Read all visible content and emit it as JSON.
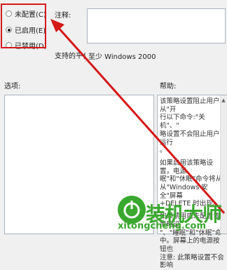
{
  "state": {
    "options": [
      {
        "label": "未配置(C)",
        "checked": false
      },
      {
        "label": "已启用(E)",
        "checked": true
      },
      {
        "label": "已禁用(D)",
        "checked": false
      }
    ]
  },
  "comment": {
    "label": "注释:"
  },
  "supported": {
    "label": "支持的平台",
    "value": "至少 Windows 2000"
  },
  "options_section": {
    "label": "选项:"
  },
  "help_section": {
    "label": "帮助:",
    "lines": [
      "该策略设置阻止用户从\"开",
      "行以下命令:\"关机\"、\"",
      "略设置不会阻止用户运行",
      "。",
      "如果启用该策略设置，电源",
      "眠\"和\"休眠\"命令将从",
      "从\"Windows 安全\"屏幕",
      "+DELETE 时出现。",
      "如果禁用或未配置该策略设",
      "\"、\"睡眠\"和\"休眠\"命",
      "中。屏幕上的电源按钮也",
      "注意: 此策略设置不会影响"
    ]
  },
  "watermark": {
    "brand": "装机大师",
    "url": "xitongcheng.com"
  },
  "colors": {
    "annotation": "#d51818",
    "logo": "#3aa82f"
  }
}
